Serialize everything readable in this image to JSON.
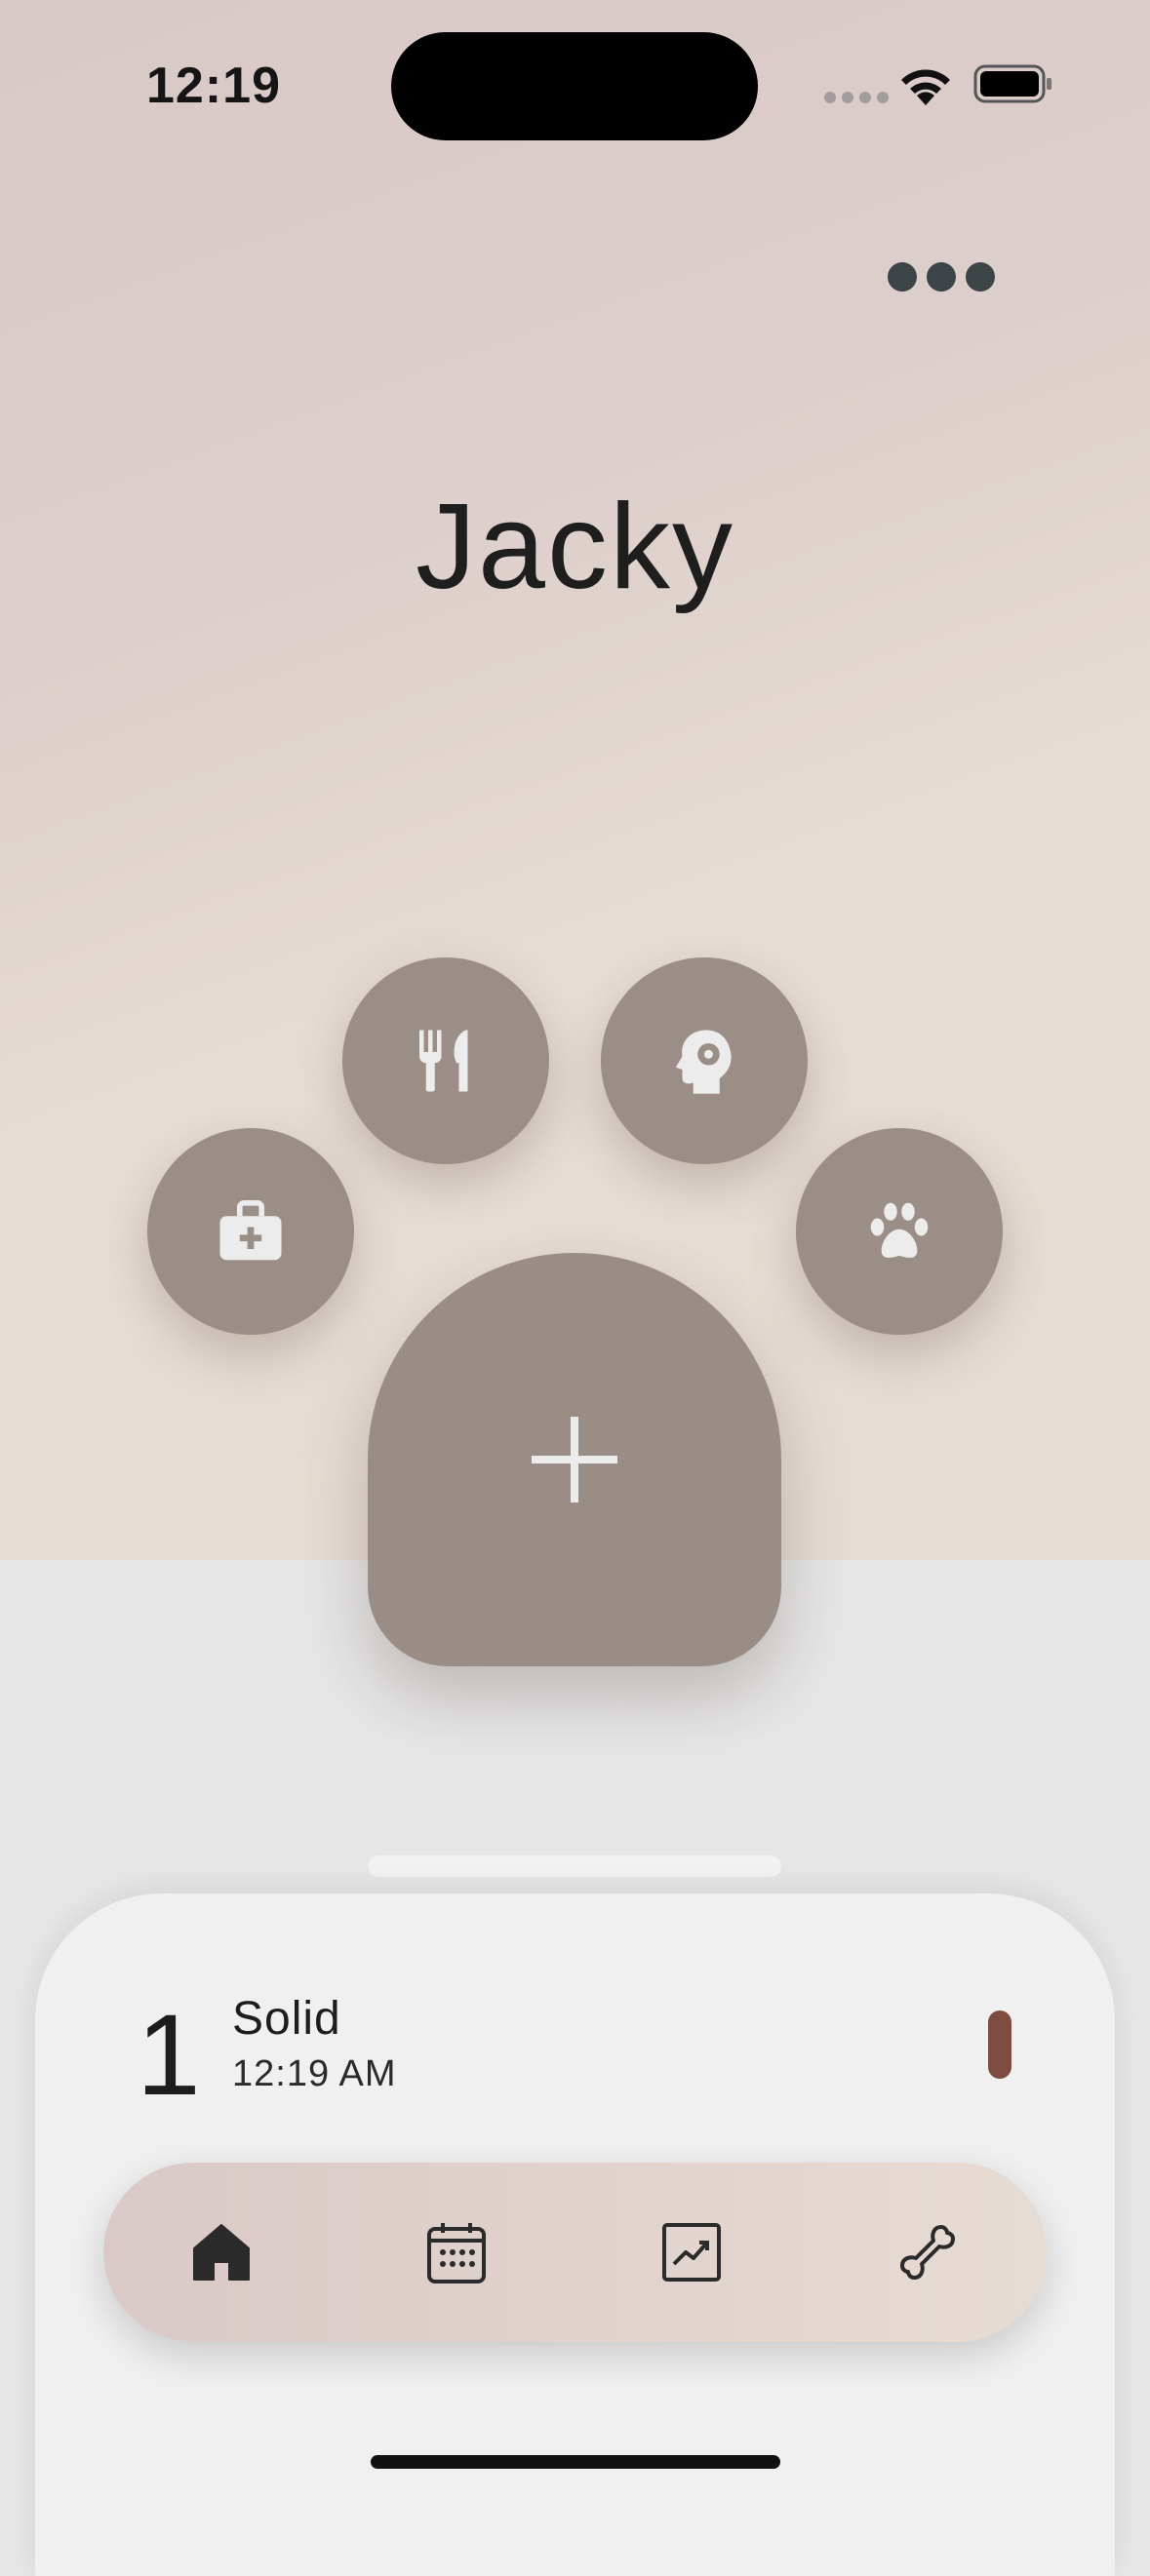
{
  "status_bar": {
    "time": "12:19"
  },
  "pet": {
    "name": "Jacky"
  },
  "paw_menu": {
    "items": [
      {
        "name": "medical",
        "icon": "medical-kit-icon"
      },
      {
        "name": "food",
        "icon": "fork-knife-icon"
      },
      {
        "name": "behavior",
        "icon": "head-gear-icon"
      },
      {
        "name": "activity",
        "icon": "paw-icon"
      }
    ],
    "main_action": {
      "icon": "plus-icon"
    }
  },
  "recent_entry": {
    "index": "1",
    "type": "Solid",
    "time": "12:19 AM",
    "color": "#7e4c3f"
  },
  "tab_bar": {
    "tabs": [
      {
        "name": "home",
        "icon": "home-icon",
        "selected": true
      },
      {
        "name": "calendar",
        "icon": "calendar-icon",
        "selected": false
      },
      {
        "name": "stats",
        "icon": "trend-chart-icon",
        "selected": false
      },
      {
        "name": "bone",
        "icon": "bone-icon",
        "selected": false
      }
    ]
  },
  "colors": {
    "paw_fill": "#9b8e86",
    "icon_light": "#ececec",
    "text_dark": "#1e1e1e"
  }
}
